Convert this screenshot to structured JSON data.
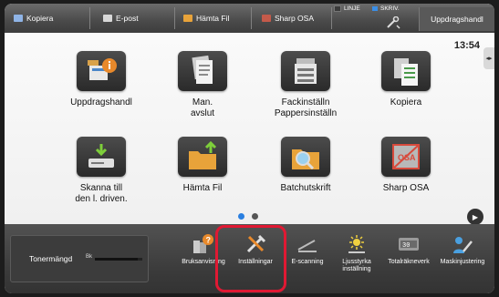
{
  "topbar": {
    "items": [
      {
        "label": "Kopiera",
        "icon": "copy-icon",
        "color": "#8fb4e6"
      },
      {
        "label": "E-post",
        "icon": "envelope-icon",
        "color": "#d8d8d8"
      },
      {
        "label": "Hämta Fil",
        "icon": "folder-icon",
        "color": "#e8a33a"
      },
      {
        "label": "Sharp OSA",
        "icon": "osa-icon",
        "color": "#c45a4a"
      }
    ],
    "status_linje": "LINJE",
    "status_skriv": "SKRIV.",
    "job_status_label": "Uppdragshandl"
  },
  "main": {
    "clock": "13:54",
    "tiles": [
      {
        "label": "Uppdragshandl",
        "icon": "job-status-icon"
      },
      {
        "label": "Man.\navslut",
        "icon": "manual-document-icon"
      },
      {
        "label": "Fackinställn\nPappersinställn",
        "icon": "paper-tray-icon"
      },
      {
        "label": "Kopiera",
        "icon": "copy-icon"
      },
      {
        "label": "Skanna till\nden l. driven.",
        "icon": "scan-to-local-drive-icon"
      },
      {
        "label": "Hämta Fil",
        "icon": "retrieve-file-icon"
      },
      {
        "label": "Batchutskrift",
        "icon": "batch-print-icon"
      },
      {
        "label": "Sharp OSA",
        "icon": "sharp-osa-icon"
      }
    ],
    "page_dots": {
      "active": 1,
      "total": 2,
      "active_color": "#2a7fe0",
      "inactive_color": "#555555"
    }
  },
  "bottom": {
    "toner_label": "Tonermängd",
    "toner_channel": "Bk",
    "toner_level": 0.9,
    "buttons": [
      {
        "label": "Bruksanvisning",
        "icon": "manual-help-icon"
      },
      {
        "label": "Inställningar",
        "icon": "settings-tools-icon"
      },
      {
        "label": "E-scanning",
        "icon": "e-scanning-icon"
      },
      {
        "label": "Ljusstyrka\ninställning",
        "icon": "brightness-icon"
      },
      {
        "label": "Totalräkneverk",
        "icon": "total-count-icon"
      },
      {
        "label": "Maskinjustering",
        "icon": "machine-adjustment-icon"
      }
    ],
    "highlight_color": "#e01933"
  }
}
